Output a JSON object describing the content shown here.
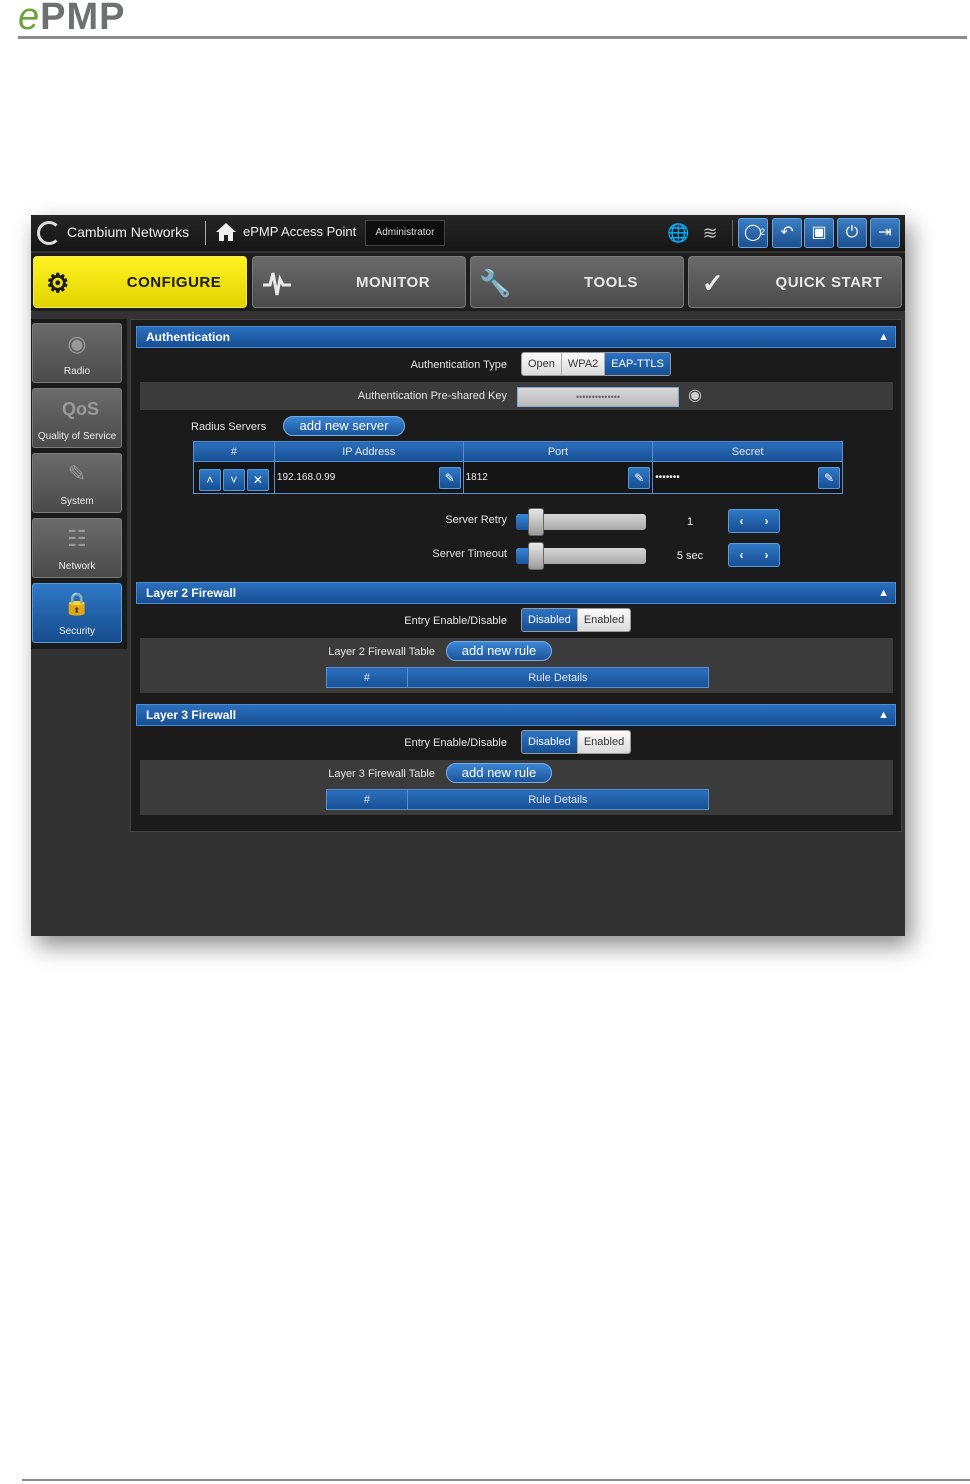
{
  "doc": {
    "logo_prefix": "e",
    "logo_rest": "PMP"
  },
  "topbar": {
    "brand": "Cambium Networks",
    "title": "ePMP Access Point",
    "user": "Administrator",
    "notification_count": "2"
  },
  "tabs": [
    {
      "label": "CONFIGURE",
      "icon": "gear-icon",
      "active": true
    },
    {
      "label": "MONITOR",
      "icon": "pulse-icon"
    },
    {
      "label": "TOOLS",
      "icon": "wrench-icon"
    },
    {
      "label": "QUICK START",
      "icon": "running-man-icon"
    }
  ],
  "sidebar": {
    "items": [
      {
        "label": "Radio",
        "icon": "radio-tower-icon"
      },
      {
        "label": "Quality of Service",
        "icon": "qos-icon"
      },
      {
        "label": "System",
        "icon": "system-edit-icon"
      },
      {
        "label": "Network",
        "icon": "network-icon"
      },
      {
        "label": "Security",
        "icon": "lock-icon",
        "active": true
      }
    ]
  },
  "authentication": {
    "title": "Authentication",
    "type_label": "Authentication Type",
    "type_options": [
      "Open",
      "WPA2",
      "EAP-TTLS"
    ],
    "type_selected": "EAP-TTLS",
    "psk_label": "Authentication Pre-shared Key",
    "psk_value": "••••••••••••••",
    "radius_label": "Radius Servers",
    "add_server": "add new server",
    "columns": [
      "#",
      "IP Address",
      "Port",
      "Secret"
    ],
    "servers": [
      {
        "ip": "192.168.0.99",
        "port": "1812",
        "secret": "•••••••"
      }
    ],
    "retry_label": "Server Retry",
    "retry_value": "1",
    "retry_level": 0.15,
    "timeout_label": "Server Timeout",
    "timeout_value": "5 sec",
    "timeout_level": 0.15
  },
  "l2": {
    "title": "Layer 2 Firewall",
    "entry_label": "Entry Enable/Disable",
    "disabled": "Disabled",
    "enabled": "Enabled",
    "table_label": "Layer 2 Firewall Table",
    "add_rule": "add new rule",
    "col_num": "#",
    "col_details": "Rule Details"
  },
  "l3": {
    "title": "Layer 3 Firewall",
    "entry_label": "Entry Enable/Disable",
    "disabled": "Disabled",
    "enabled": "Enabled",
    "table_label": "Layer 3 Firewall Table",
    "add_rule": "add new rule",
    "col_num": "#",
    "col_details": "Rule Details"
  }
}
